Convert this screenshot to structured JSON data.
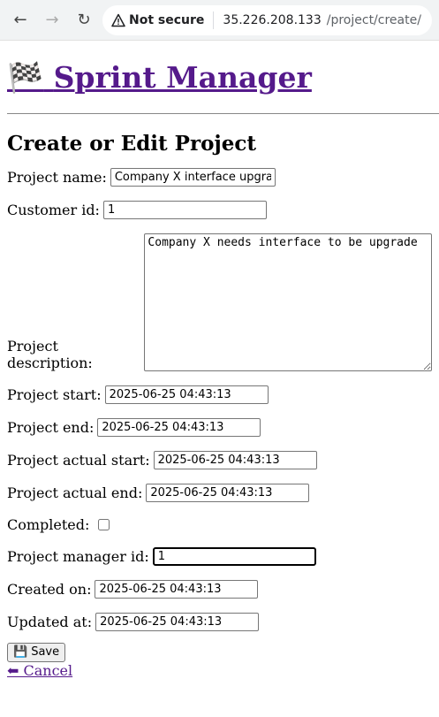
{
  "browser": {
    "security_label": "Not secure",
    "url_host": "35.226.208.133",
    "url_path": "/project/create/"
  },
  "site": {
    "flag_glyph": "🏁",
    "title": "Sprint Manager"
  },
  "form": {
    "heading": "Create or Edit Project",
    "project_name_label": "Project name:",
    "project_name_value": "Company X interface upgrade",
    "customer_id_label": "Customer id:",
    "customer_id_value": "1",
    "description_label": "Project description:",
    "description_value": "Company X needs interface to be upgrade",
    "start_label": "Project start:",
    "start_value": "2025-06-25 04:43:13",
    "end_label": "Project end:",
    "end_value": "2025-06-25 04:43:13",
    "actual_start_label": "Project actual start:",
    "actual_start_value": "2025-06-25 04:43:13",
    "actual_end_label": "Project actual end:",
    "actual_end_value": "2025-06-25 04:43:13",
    "completed_label": "Completed:",
    "manager_label": "Project manager id:",
    "manager_value": "1",
    "created_label": "Created on:",
    "created_value": "2025-06-25 04:43:13",
    "updated_label": "Updated at:",
    "updated_value": "2025-06-25 04:43:13",
    "save_icon": "💾",
    "save_label": "Save",
    "cancel_label": "⬅ Cancel"
  }
}
